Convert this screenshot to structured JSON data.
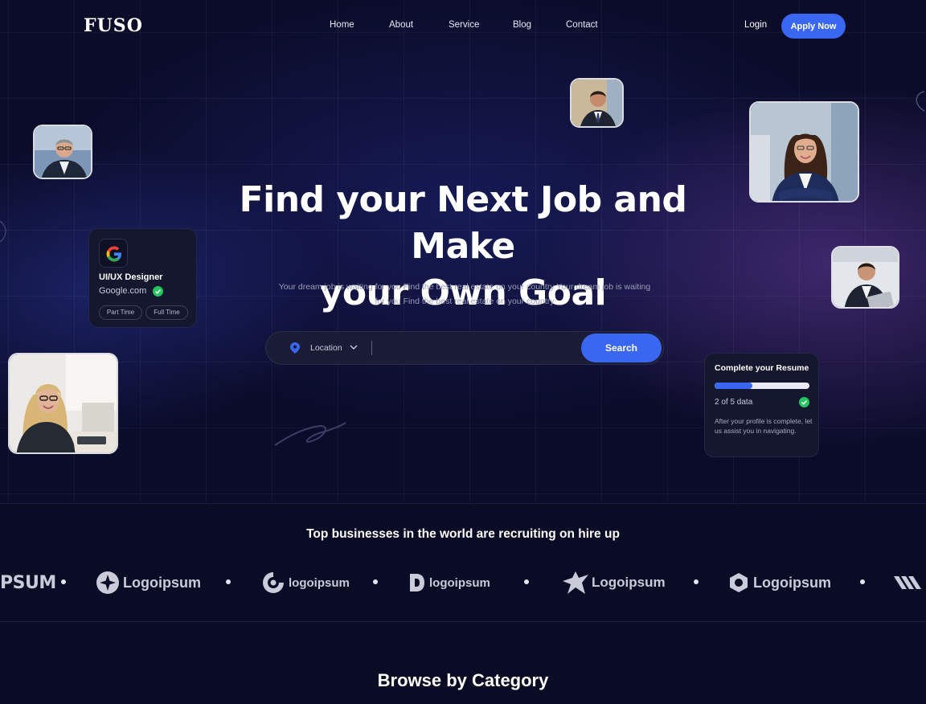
{
  "brand": {
    "logo": "FUSO"
  },
  "nav": {
    "links": [
      "Home",
      "About",
      "Service",
      "Blog",
      "Contact"
    ],
    "login": "Login",
    "apply": "Apply Now"
  },
  "hero": {
    "headline_line1": "Find your Next Job and Make",
    "headline_line2": "your Own Goal",
    "subtext": "Your dream job is waiting for you Find the best real estate on your country Your dream job is waiting for you Find the best real estate on your country"
  },
  "search": {
    "location_label": "Location",
    "query_value": "",
    "button": "Search"
  },
  "job_card": {
    "title": "UI/UX Designer",
    "company": "Google.com",
    "tags": [
      "Part Time",
      "Full Time"
    ]
  },
  "resume_card": {
    "title": "Complete your Resume",
    "progress": 0.4,
    "count": "2 of 5 data",
    "note": "After your profile is complete, let us assist you in navigating."
  },
  "trusted": {
    "title": "Top businesses in the world are recruiting on hire up",
    "logos": [
      "PSUM",
      "Logoipsum",
      "logoipsum",
      "logoipsum",
      "Logoipsum",
      "Logoipsum"
    ]
  },
  "browse": {
    "title": "Browse by Category"
  },
  "colors": {
    "accent": "#3a67f2",
    "background": "#0a0b24",
    "card": "#15172e",
    "success": "#22c55e"
  }
}
